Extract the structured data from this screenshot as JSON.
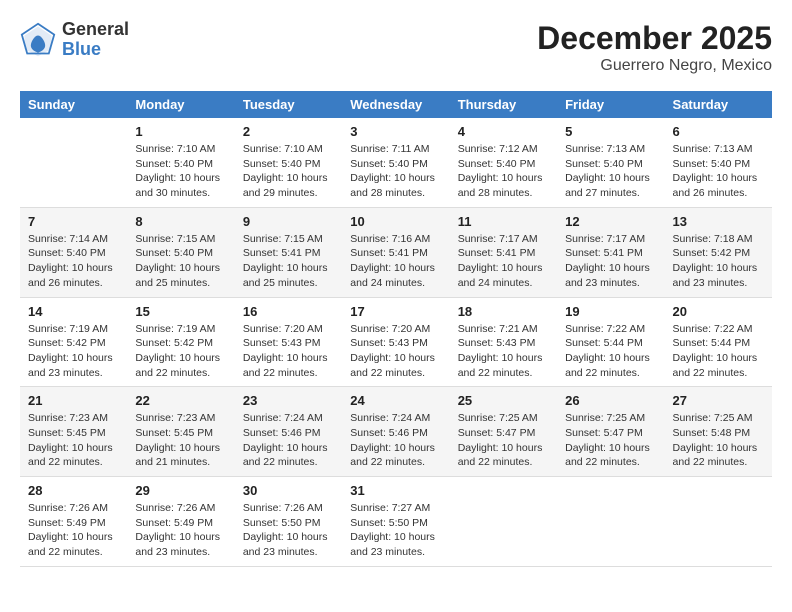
{
  "header": {
    "logo": {
      "line1": "General",
      "line2": "Blue"
    },
    "title": "December 2025",
    "subtitle": "Guerrero Negro, Mexico"
  },
  "calendar": {
    "days_of_week": [
      "Sunday",
      "Monday",
      "Tuesday",
      "Wednesday",
      "Thursday",
      "Friday",
      "Saturday"
    ],
    "weeks": [
      [
        {
          "day": "",
          "info": ""
        },
        {
          "day": "1",
          "info": "Sunrise: 7:10 AM\nSunset: 5:40 PM\nDaylight: 10 hours\nand 30 minutes."
        },
        {
          "day": "2",
          "info": "Sunrise: 7:10 AM\nSunset: 5:40 PM\nDaylight: 10 hours\nand 29 minutes."
        },
        {
          "day": "3",
          "info": "Sunrise: 7:11 AM\nSunset: 5:40 PM\nDaylight: 10 hours\nand 28 minutes."
        },
        {
          "day": "4",
          "info": "Sunrise: 7:12 AM\nSunset: 5:40 PM\nDaylight: 10 hours\nand 28 minutes."
        },
        {
          "day": "5",
          "info": "Sunrise: 7:13 AM\nSunset: 5:40 PM\nDaylight: 10 hours\nand 27 minutes."
        },
        {
          "day": "6",
          "info": "Sunrise: 7:13 AM\nSunset: 5:40 PM\nDaylight: 10 hours\nand 26 minutes."
        }
      ],
      [
        {
          "day": "7",
          "info": "Sunrise: 7:14 AM\nSunset: 5:40 PM\nDaylight: 10 hours\nand 26 minutes."
        },
        {
          "day": "8",
          "info": "Sunrise: 7:15 AM\nSunset: 5:40 PM\nDaylight: 10 hours\nand 25 minutes."
        },
        {
          "day": "9",
          "info": "Sunrise: 7:15 AM\nSunset: 5:41 PM\nDaylight: 10 hours\nand 25 minutes."
        },
        {
          "day": "10",
          "info": "Sunrise: 7:16 AM\nSunset: 5:41 PM\nDaylight: 10 hours\nand 24 minutes."
        },
        {
          "day": "11",
          "info": "Sunrise: 7:17 AM\nSunset: 5:41 PM\nDaylight: 10 hours\nand 24 minutes."
        },
        {
          "day": "12",
          "info": "Sunrise: 7:17 AM\nSunset: 5:41 PM\nDaylight: 10 hours\nand 23 minutes."
        },
        {
          "day": "13",
          "info": "Sunrise: 7:18 AM\nSunset: 5:42 PM\nDaylight: 10 hours\nand 23 minutes."
        }
      ],
      [
        {
          "day": "14",
          "info": "Sunrise: 7:19 AM\nSunset: 5:42 PM\nDaylight: 10 hours\nand 23 minutes."
        },
        {
          "day": "15",
          "info": "Sunrise: 7:19 AM\nSunset: 5:42 PM\nDaylight: 10 hours\nand 22 minutes."
        },
        {
          "day": "16",
          "info": "Sunrise: 7:20 AM\nSunset: 5:43 PM\nDaylight: 10 hours\nand 22 minutes."
        },
        {
          "day": "17",
          "info": "Sunrise: 7:20 AM\nSunset: 5:43 PM\nDaylight: 10 hours\nand 22 minutes."
        },
        {
          "day": "18",
          "info": "Sunrise: 7:21 AM\nSunset: 5:43 PM\nDaylight: 10 hours\nand 22 minutes."
        },
        {
          "day": "19",
          "info": "Sunrise: 7:22 AM\nSunset: 5:44 PM\nDaylight: 10 hours\nand 22 minutes."
        },
        {
          "day": "20",
          "info": "Sunrise: 7:22 AM\nSunset: 5:44 PM\nDaylight: 10 hours\nand 22 minutes."
        }
      ],
      [
        {
          "day": "21",
          "info": "Sunrise: 7:23 AM\nSunset: 5:45 PM\nDaylight: 10 hours\nand 22 minutes."
        },
        {
          "day": "22",
          "info": "Sunrise: 7:23 AM\nSunset: 5:45 PM\nDaylight: 10 hours\nand 21 minutes."
        },
        {
          "day": "23",
          "info": "Sunrise: 7:24 AM\nSunset: 5:46 PM\nDaylight: 10 hours\nand 22 minutes."
        },
        {
          "day": "24",
          "info": "Sunrise: 7:24 AM\nSunset: 5:46 PM\nDaylight: 10 hours\nand 22 minutes."
        },
        {
          "day": "25",
          "info": "Sunrise: 7:25 AM\nSunset: 5:47 PM\nDaylight: 10 hours\nand 22 minutes."
        },
        {
          "day": "26",
          "info": "Sunrise: 7:25 AM\nSunset: 5:47 PM\nDaylight: 10 hours\nand 22 minutes."
        },
        {
          "day": "27",
          "info": "Sunrise: 7:25 AM\nSunset: 5:48 PM\nDaylight: 10 hours\nand 22 minutes."
        }
      ],
      [
        {
          "day": "28",
          "info": "Sunrise: 7:26 AM\nSunset: 5:49 PM\nDaylight: 10 hours\nand 22 minutes."
        },
        {
          "day": "29",
          "info": "Sunrise: 7:26 AM\nSunset: 5:49 PM\nDaylight: 10 hours\nand 23 minutes."
        },
        {
          "day": "30",
          "info": "Sunrise: 7:26 AM\nSunset: 5:50 PM\nDaylight: 10 hours\nand 23 minutes."
        },
        {
          "day": "31",
          "info": "Sunrise: 7:27 AM\nSunset: 5:50 PM\nDaylight: 10 hours\nand 23 minutes."
        },
        {
          "day": "",
          "info": ""
        },
        {
          "day": "",
          "info": ""
        },
        {
          "day": "",
          "info": ""
        }
      ]
    ]
  }
}
